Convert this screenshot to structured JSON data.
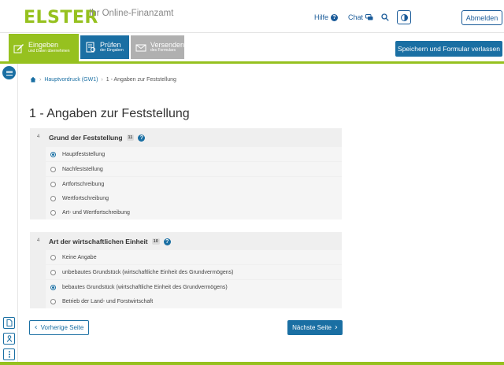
{
  "header": {
    "logo": "ELSTER",
    "logo_sub": "Ihr Online-Finanzamt",
    "help_label": "Hilfe",
    "chat_label": "Chat",
    "logout_label": "Abmelden"
  },
  "steps": [
    {
      "title": "Eingeben",
      "sub": "und Daten übernehmen"
    },
    {
      "title": "Prüfen",
      "sub": "der Eingaben"
    },
    {
      "title": "Versenden",
      "sub": "des Formulars"
    }
  ],
  "save_label": "Speichern und Formular verlassen",
  "breadcrumb": {
    "link": "Hauptvordruck (GW1)",
    "current": "1 - Angaben zur Feststellung"
  },
  "page_title": "1 - Angaben zur Feststellung",
  "sections": [
    {
      "num": "4",
      "title": "Grund der Feststellung",
      "badge": "11",
      "options": [
        "Hauptfeststellung",
        "Nachfeststellung",
        "Artfortschreibung",
        "Wertfortschreibung",
        "Art- und Wertfortschreibung"
      ],
      "selected": 0
    },
    {
      "num": "4",
      "title": "Art der wirtschaftlichen Einheit",
      "badge": "10",
      "options": [
        "Keine Angabe",
        "unbebautes Grundstück (wirtschaftliche Einheit des Grundvermögens)",
        "bebautes Grundstück (wirtschaftliche Einheit des Grundvermögens)",
        "Betrieb der Land- und Forstwirtschaft"
      ],
      "selected": 2
    }
  ],
  "nav": {
    "prev_label": "Vorherige Seite",
    "next_label": "Nächste Seite"
  },
  "colors": {
    "brand_green": "#96c11f",
    "primary_blue": "#1a6fa3",
    "disabled_gray": "#b0b0b0"
  }
}
